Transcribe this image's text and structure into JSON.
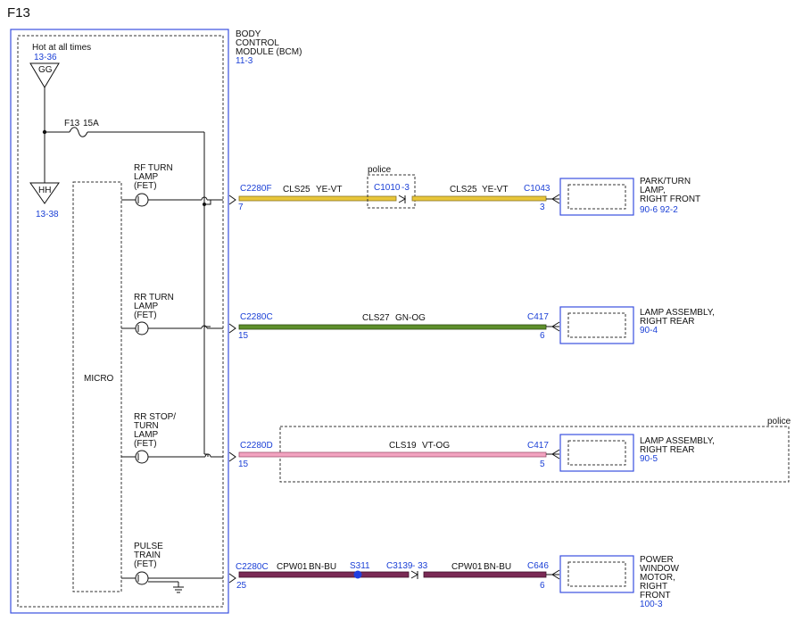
{
  "title": "F13",
  "bcm": {
    "name_lines": [
      "BODY",
      "CONTROL",
      "MODULE (BCM)"
    ],
    "ref": "11-3",
    "hot_label": "Hot at all times",
    "gg": {
      "label": "GG",
      "ref": "13-36"
    },
    "hh": {
      "label": "HH",
      "ref": "13-38"
    },
    "fuse": {
      "name": "F13",
      "rating": "15A"
    },
    "micro_label": "MICRO",
    "outputs": [
      {
        "lines": [
          "RF TURN",
          "LAMP",
          "(FET)"
        ]
      },
      {
        "lines": [
          "RR TURN",
          "LAMP",
          "(FET)"
        ]
      },
      {
        "lines": [
          "RR STOP/",
          "TURN",
          "LAMP",
          "(FET)"
        ]
      },
      {
        "lines": [
          "PULSE",
          "TRAIN",
          "(FET)"
        ]
      }
    ]
  },
  "circuits": [
    {
      "color": "#e8c63a",
      "connector": "C2280F",
      "pin": "7",
      "segments": [
        {
          "circuit": "CLS25",
          "wire": "YE-VT"
        },
        {
          "circuit": "CLS25",
          "wire": "YE-VT"
        }
      ],
      "inline": {
        "connector": "C1010",
        "pin": "-3",
        "note": "police"
      },
      "end_connector": "C1043",
      "end_pin": "3",
      "device": {
        "lines": [
          "PARK/TURN",
          "LAMP,",
          "RIGHT FRONT"
        ],
        "refs": "90-6   92-2"
      }
    },
    {
      "color": "#5e8f2b",
      "connector": "C2280C",
      "pin": "15",
      "segments": [
        {
          "circuit": "CLS27",
          "wire": "GN-OG"
        }
      ],
      "end_connector": "C417",
      "end_pin": "6",
      "device": {
        "lines": [
          "LAMP ASSEMBLY,",
          "RIGHT REAR"
        ],
        "refs": "90-4"
      }
    },
    {
      "color": "#f2a3c0",
      "connector": "C2280D",
      "pin": "15",
      "segments": [
        {
          "circuit": "CLS19",
          "wire": "VT-OG"
        }
      ],
      "end_connector": "C417",
      "end_pin": "5",
      "group_note": "police",
      "device": {
        "lines": [
          "LAMP ASSEMBLY,",
          "RIGHT REAR"
        ],
        "refs": "90-5"
      }
    },
    {
      "color": "#7a2a55",
      "connector": "C2280C",
      "pin": "25",
      "segments": [
        {
          "circuit": "CPW01",
          "wire": "BN-BU"
        },
        {
          "circuit": "CPW01",
          "wire": "BN-BU"
        }
      ],
      "splice": "S311",
      "inline": {
        "connector": "C3139",
        "pin": "- 33"
      },
      "end_connector": "C646",
      "end_pin": "6",
      "device": {
        "lines": [
          "POWER",
          "WINDOW",
          "MOTOR,",
          "RIGHT",
          "FRONT"
        ],
        "refs": "100-3"
      }
    }
  ]
}
